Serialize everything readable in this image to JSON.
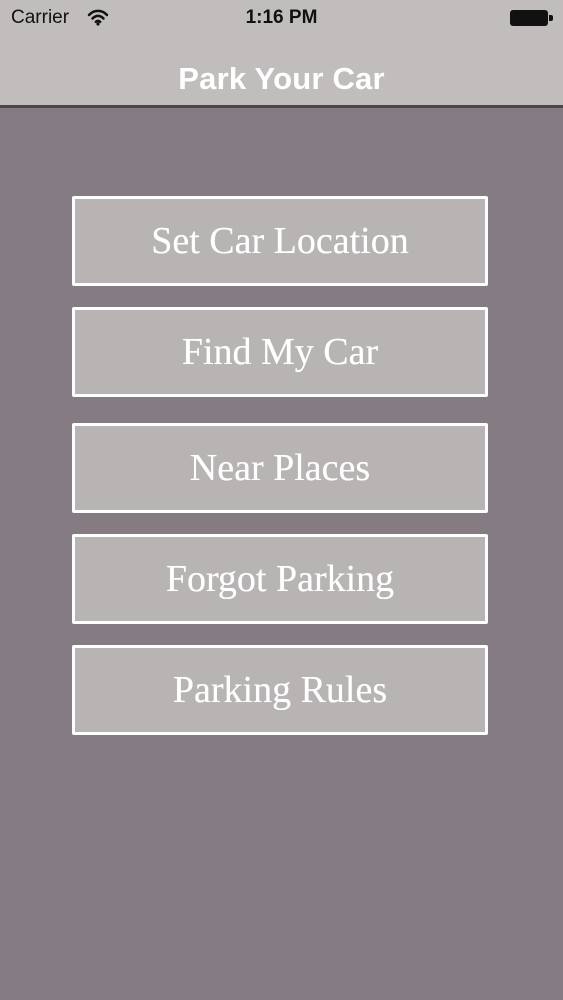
{
  "status_bar": {
    "carrier": "Carrier",
    "time": "1:16 PM",
    "wifi_icon": "wifi-icon",
    "battery_icon": "battery-icon"
  },
  "navigation": {
    "title": "Park Your Car"
  },
  "menu": {
    "buttons": [
      {
        "label": "Set Car Location"
      },
      {
        "label": "Find My Car"
      },
      {
        "label": "Near Places"
      },
      {
        "label": "Forgot Parking"
      },
      {
        "label": "Parking Rules"
      }
    ]
  },
  "colors": {
    "background": "#857b83",
    "navigation_bar": "#c1bdbd",
    "button_fill": "#b9b4b4",
    "button_border_and_text": "#ffffff"
  }
}
